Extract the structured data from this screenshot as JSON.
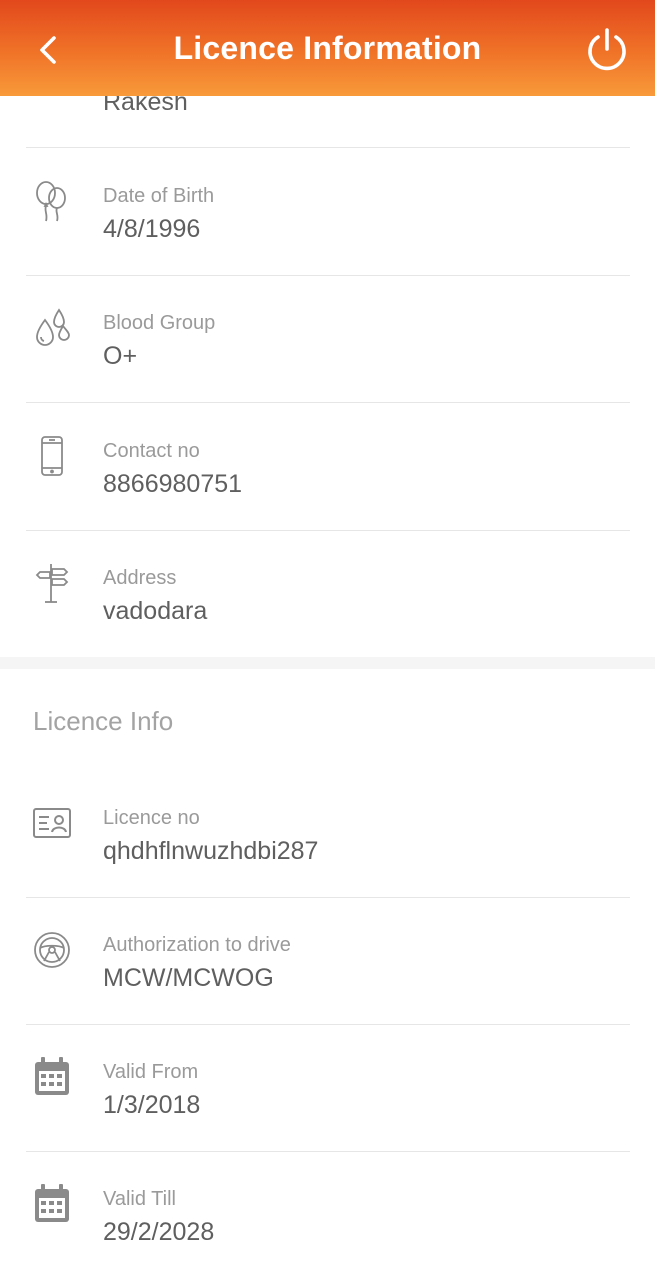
{
  "header": {
    "title": "Licence Information",
    "back_icon": "chevron-left-icon",
    "power_icon": "power-icon"
  },
  "personal": {
    "partial_name": "Rakesh",
    "rows": [
      {
        "icon": "balloons-icon",
        "label": "Date of Birth",
        "value": "4/8/1996"
      },
      {
        "icon": "blood-drops-icon",
        "label": "Blood Group",
        "value": "O+"
      },
      {
        "icon": "phone-icon",
        "label": "Contact no",
        "value": "8866980751"
      },
      {
        "icon": "signpost-icon",
        "label": "Address",
        "value": "vadodara"
      }
    ]
  },
  "licence": {
    "section_title": "Licence Info",
    "rows": [
      {
        "icon": "id-card-icon",
        "label": "Licence no",
        "value": "qhdhflnwuzhdbi287"
      },
      {
        "icon": "steering-wheel-icon",
        "label": "Authorization to drive",
        "value": "MCW/MCWOG"
      },
      {
        "icon": "calendar-icon",
        "label": "Valid From",
        "value": "1/3/2018"
      },
      {
        "icon": "calendar-icon",
        "label": "Valid Till",
        "value": "29/2/2028"
      }
    ]
  }
}
